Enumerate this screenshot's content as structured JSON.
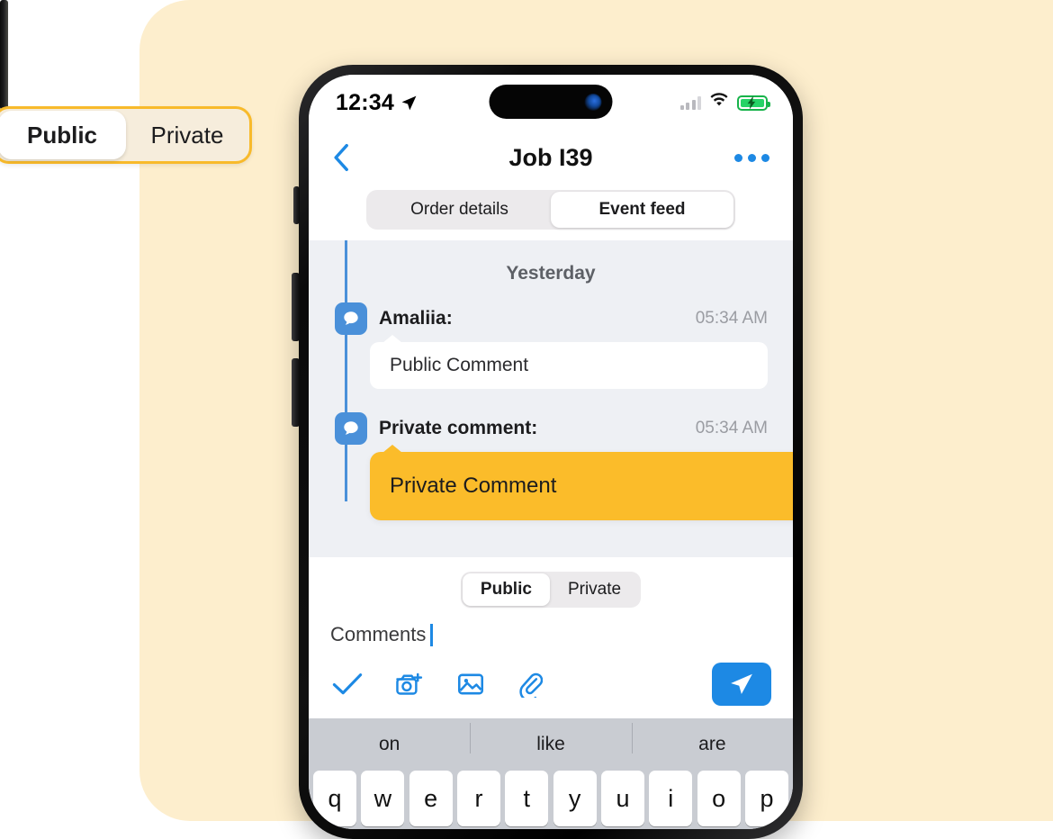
{
  "callout": {
    "options": [
      {
        "label": "Public",
        "active": true
      },
      {
        "label": "Private",
        "active": false
      }
    ]
  },
  "phone": {
    "status_bar": {
      "time": "12:34",
      "location_icon": "location-arrow-icon",
      "signal_icon": "cellular-signal-icon",
      "wifi_icon": "wifi-icon",
      "battery_icon": "battery-charging-icon",
      "battery_color": "#25d366"
    },
    "nav": {
      "back_icon": "chevron-left-icon",
      "title": "Job I39",
      "more_icon": "more-horizontal-icon"
    },
    "tabs": [
      {
        "label": "Order details",
        "active": false
      },
      {
        "label": "Event feed",
        "active": true
      }
    ],
    "feed": {
      "day_label": "Yesterday",
      "events": [
        {
          "icon": "comment-bubble-icon",
          "author": "Amaliia:",
          "time": "05:34 AM",
          "body": "Public Comment",
          "kind": "public"
        },
        {
          "icon": "comment-bubble-icon",
          "author": "Private comment:",
          "time": "05:34 AM",
          "body": "Private Comment",
          "kind": "private"
        }
      ]
    },
    "composer": {
      "visibility": [
        {
          "label": "Public",
          "active": true
        },
        {
          "label": "Private",
          "active": false
        }
      ],
      "input_value": "Comments",
      "actions": [
        {
          "name": "checkmark-icon"
        },
        {
          "name": "camera-add-icon"
        },
        {
          "name": "image-icon"
        },
        {
          "name": "paperclip-icon"
        }
      ],
      "send_icon": "send-paper-plane-icon",
      "send_color": "#1d89e4"
    },
    "keyboard": {
      "suggestions": [
        "on",
        "like",
        "are"
      ],
      "row": [
        "q",
        "w",
        "e",
        "r",
        "t",
        "y",
        "u",
        "i",
        "o",
        "p"
      ]
    }
  },
  "theme": {
    "page_bg": "#fdeecd",
    "accent_yellow": "#fbbc2a",
    "accent_blue": "#1d89e4",
    "feed_bg": "#eef0f4"
  }
}
